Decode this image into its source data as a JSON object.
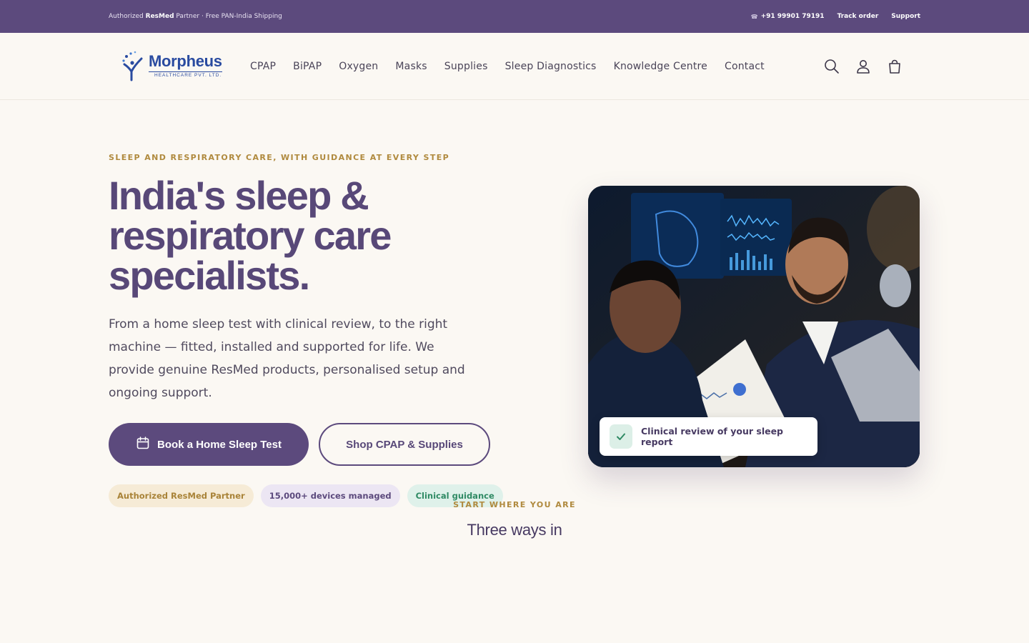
{
  "topbar": {
    "promo_prefix": "Authorized ",
    "promo_brand": "ResMed",
    "promo_suffix": " Partner · Free PAN-India Shipping",
    "phone": "+91 99901 79191",
    "track_order": "Track order",
    "support": "Support"
  },
  "logo": {
    "name": "Morpheus",
    "sub": "HEALTHCARE PVT. LTD."
  },
  "nav": {
    "items": [
      {
        "label": "CPAP"
      },
      {
        "label": "BiPAP"
      },
      {
        "label": "Oxygen"
      },
      {
        "label": "Masks"
      },
      {
        "label": "Supplies"
      },
      {
        "label": "Sleep Diagnostics"
      },
      {
        "label": "Knowledge Centre"
      },
      {
        "label": "Contact"
      }
    ]
  },
  "header_icons": [
    "search-icon",
    "account-icon",
    "cart-icon"
  ],
  "hero": {
    "eyebrow": "SLEEP AND RESPIRATORY CARE, WITH GUIDANCE AT EVERY STEP",
    "headline_line1": "India's sleep &",
    "headline_line2": "respiratory care",
    "headline_line3": "specialists.",
    "lede": "From a home sleep test with clinical review, to the right machine — fitted, installed and supported for life. We provide genuine ResMed products, personalised setup and ongoing support.",
    "primary_cta": "Book a Home Sleep Test",
    "secondary_cta": "Shop CPAP & Supplies",
    "badges": [
      {
        "label": "Authorized ResMed Partner",
        "tone": "gold"
      },
      {
        "label": "15,000+ devices managed",
        "tone": "purple"
      },
      {
        "label": "Clinical guidance",
        "tone": "green"
      }
    ],
    "photo_caption": "Clinical review of your sleep report"
  },
  "section2": {
    "kicker": "START WHERE YOU ARE",
    "title": "Three ways in"
  },
  "colors": {
    "brand_purple": "#5c4a7d",
    "headline_purple": "#584878",
    "accent_gold": "#b08a3e",
    "background": "#fbf8f3",
    "badge_green": "#2f8a64"
  }
}
